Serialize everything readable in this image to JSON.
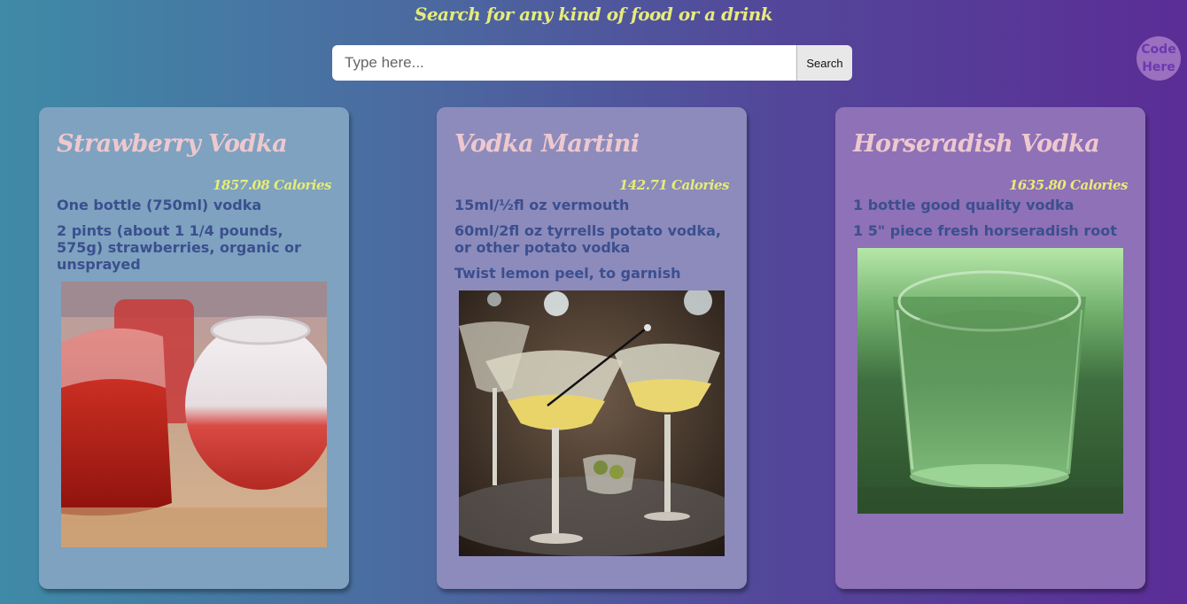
{
  "header": {
    "title": "Search for any kind of food or a drink",
    "search_placeholder": "Type here...",
    "search_value": "",
    "search_button": "Search",
    "code_link": [
      "Code",
      "Here"
    ]
  },
  "cards": [
    {
      "title": "Strawberry Vodka",
      "calories": "1857.08 Calories",
      "ingredients": [
        "One bottle (750ml) vodka",
        "2 pints (about 1 1/4 pounds, 575g) strawberries, organic or unsprayed"
      ]
    },
    {
      "title": "Vodka Martini",
      "calories": "142.71 Calories",
      "ingredients": [
        "15ml/½fl oz vermouth",
        "60ml/2fl oz tyrrells potato vodka, or other potato vodka",
        "Twist lemon peel, to garnish"
      ]
    },
    {
      "title": "Horseradish Vodka",
      "calories": "1635.80 Calories",
      "ingredients": [
        "1 bottle good quality vodka",
        "1 5\" piece fresh horseradish root"
      ]
    }
  ]
}
